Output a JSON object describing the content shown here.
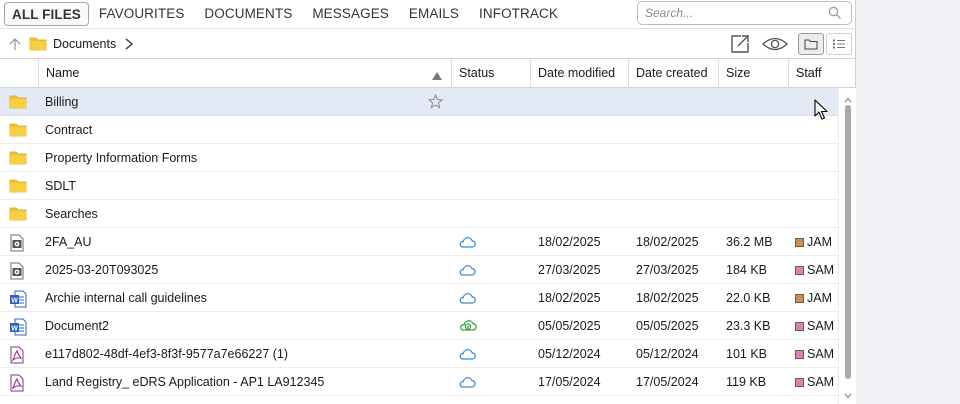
{
  "tabs": [
    "ALL FILES",
    "FAVOURITES",
    "DOCUMENTS",
    "MESSAGES",
    "EMAILS",
    "INFOTRACK"
  ],
  "search": {
    "placeholder": "Search..."
  },
  "breadcrumb": {
    "label": "Documents"
  },
  "columns": {
    "name": "Name",
    "status": "Status",
    "modified": "Date modified",
    "created": "Date created",
    "size": "Size",
    "staff": "Staff"
  },
  "rows": [
    {
      "icon": "folder-icon",
      "name": "Billing",
      "status": "",
      "modified": "",
      "created": "",
      "size": "",
      "staff": "",
      "staff_color": "",
      "selected": true
    },
    {
      "icon": "folder-icon",
      "name": "Contract",
      "status": "",
      "modified": "",
      "created": "",
      "size": "",
      "staff": "",
      "staff_color": ""
    },
    {
      "icon": "folder-icon",
      "name": "Property Information Forms",
      "status": "",
      "modified": "",
      "created": "",
      "size": "",
      "staff": "",
      "staff_color": ""
    },
    {
      "icon": "folder-icon",
      "name": "SDLT",
      "status": "",
      "modified": "",
      "created": "",
      "size": "",
      "staff": "",
      "staff_color": ""
    },
    {
      "icon": "folder-icon",
      "name": "Searches",
      "status": "",
      "modified": "",
      "created": "",
      "size": "",
      "staff": "",
      "staff_color": ""
    },
    {
      "icon": "video-file-icon",
      "name": "2FA_AU",
      "status": "cloud-icon",
      "modified": "18/02/2025",
      "created": "18/02/2025",
      "size": "36.2 MB",
      "staff": "JAM",
      "staff_color": "#c8915a"
    },
    {
      "icon": "video-file-icon",
      "name": "2025-03-20T093025",
      "status": "cloud-icon",
      "modified": "27/03/2025",
      "created": "27/03/2025",
      "size": "184 KB",
      "staff": "SAM",
      "staff_color": "#d77fc0"
    },
    {
      "icon": "word-file-icon",
      "name": "Archie internal call guidelines",
      "status": "cloud-icon",
      "modified": "18/02/2025",
      "created": "18/02/2025",
      "size": "22.0 KB",
      "staff": "JAM",
      "staff_color": "#c8915a"
    },
    {
      "icon": "word-file-icon",
      "name": "Document2",
      "status": "cloud-synced-icon",
      "modified": "05/05/2025",
      "created": "05/05/2025",
      "size": "23.3 KB",
      "staff": "SAM",
      "staff_color": "#d77fc0"
    },
    {
      "icon": "pdf-file-icon",
      "name": "e117d802-48df-4ef3-8f3f-9577a7e66227 (1)",
      "status": "cloud-icon",
      "modified": "05/12/2024",
      "created": "05/12/2024",
      "size": "101 KB",
      "staff": "SAM",
      "staff_color": "#d77fc0"
    },
    {
      "icon": "pdf-file-icon",
      "name": "Land Registry_ eDRS Application - AP1 LA912345",
      "status": "cloud-icon",
      "modified": "17/05/2024",
      "created": "17/05/2024",
      "size": "119 KB",
      "staff": "SAM",
      "staff_color": "#d77fc0"
    }
  ]
}
